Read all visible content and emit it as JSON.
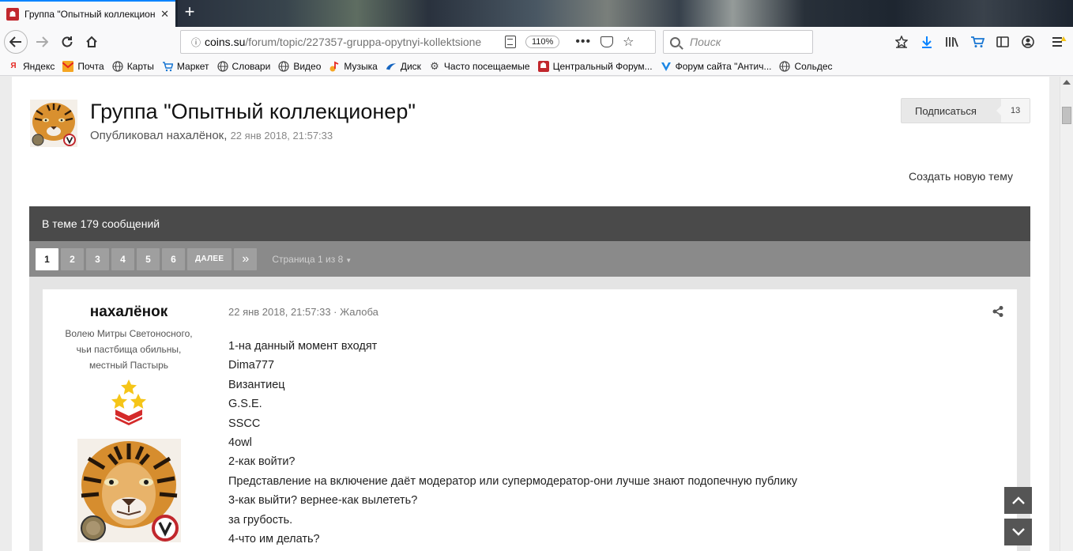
{
  "browser": {
    "tab": {
      "favicon": "coins-favicon",
      "title": "Группа \"Опытный коллекционер\""
    },
    "url": {
      "host": "coins.su",
      "path": "/forum/topic/227357-gruppa-opytnyi-kollektsione",
      "zoom": "110%"
    },
    "search": {
      "placeholder": "Поиск"
    },
    "bookmarks": [
      {
        "label": "Яндекс",
        "icon": "yandex-icon"
      },
      {
        "label": "Почта",
        "icon": "mail-icon"
      },
      {
        "label": "Карты",
        "icon": "globe-icon"
      },
      {
        "label": "Маркет",
        "icon": "cart-icon"
      },
      {
        "label": "Словари",
        "icon": "globe-icon"
      },
      {
        "label": "Видео",
        "icon": "globe-icon"
      },
      {
        "label": "Музыка",
        "icon": "music-icon"
      },
      {
        "label": "Диск",
        "icon": "disk-icon"
      },
      {
        "label": "Часто посещаемые",
        "icon": "gear-icon"
      },
      {
        "label": "Центральный Форум...",
        "icon": "coins-favicon"
      },
      {
        "label": "Форум сайта \"Антич...",
        "icon": "antique-icon"
      },
      {
        "label": "Сольдес",
        "icon": "globe-icon"
      }
    ]
  },
  "topic": {
    "title": "Группа \"Опытный коллекционер\"",
    "byline": "Опубликовал нахалёнок",
    "date": "22 янв 2018, 21:57:33",
    "follow_label": "Подписаться",
    "follow_count": "13",
    "new_topic_label": "Создать новую тему",
    "posts_count_text": "В теме 179 сообщений"
  },
  "pagination": {
    "pages": [
      "1",
      "2",
      "3",
      "4",
      "5",
      "6"
    ],
    "active": "1",
    "next_label": "ДАЛЕЕ",
    "last_label": "»",
    "page_of": "Страница 1 из 8"
  },
  "post": {
    "author": "нахалёнок",
    "author_title_lines": [
      "Волею Митры Светоносного,",
      "чьи пастбища обильны,",
      "местный Пастырь"
    ],
    "date": "22 янв 2018, 21:57:33",
    "report_label": "Жалоба",
    "body_lines": [
      "1-на данный момент входят",
      "Dima777",
      "Византиец",
      "G.S.E.",
      "SSCC",
      "4owl",
      "2-как войти?",
      "Представление на включение даёт модератор или супермодератор-они лучше знают подопечную публику",
      "3-как выйти? вернее-как вылететь?",
      "за грубость.",
      "4-что им делать?"
    ]
  },
  "colors": {
    "posts_bar": "#4a4a4a",
    "pager_bar": "#8a8a8a",
    "tab_accent": "#0a84ff",
    "rank_star": "#f5c518",
    "rank_chevron": "#d42a2a"
  }
}
